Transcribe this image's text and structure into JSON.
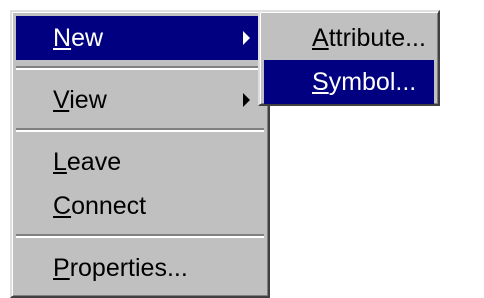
{
  "context_menu": {
    "items": [
      {
        "label": "New",
        "mnemonic": "N",
        "rest": "ew",
        "has_submenu": true,
        "selected": true
      },
      {
        "label": "View",
        "mnemonic": "V",
        "rest": "iew",
        "has_submenu": true,
        "selected": false
      },
      {
        "label": "Leave",
        "mnemonic": "L",
        "rest": "eave",
        "has_submenu": false,
        "selected": false
      },
      {
        "label": "Connect",
        "mnemonic": "C",
        "rest": "onnect",
        "has_submenu": false,
        "selected": false
      },
      {
        "label": "Properties...",
        "mnemonic": "P",
        "rest": "roperties...",
        "has_submenu": false,
        "selected": false
      }
    ]
  },
  "new_submenu": {
    "items": [
      {
        "label": "Attribute...",
        "mnemonic": "A",
        "rest": "ttribute...",
        "selected": false
      },
      {
        "label": "Symbol...",
        "mnemonic": "S",
        "rest": "ymbol...",
        "selected": true
      }
    ]
  },
  "colors": {
    "menu_background": "#c0c0c0",
    "highlight_background": "#000080",
    "highlight_text": "#ffffff",
    "text": "#000000"
  },
  "icons": {
    "submenu_indicator": "triangle-right-icon"
  }
}
